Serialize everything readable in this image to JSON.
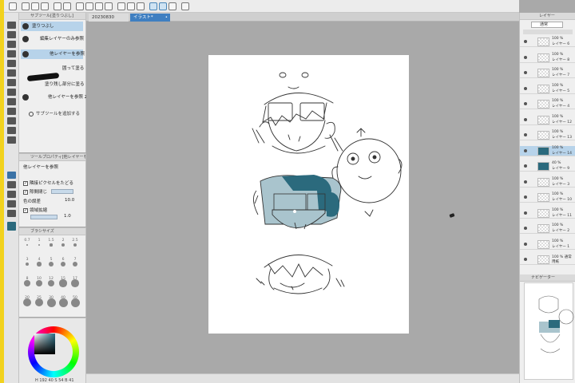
{
  "tabs": [
    {
      "label": "20230830"
    },
    {
      "label": "イラスト*"
    }
  ],
  "subtool": {
    "title": "サブツール[塗りつぶし]",
    "items": [
      {
        "label": "塗りつぶし"
      },
      {
        "label": "編集レイヤーのみ参照"
      },
      {
        "label": "他レイヤーを参照"
      },
      {
        "label": "囲って塗る"
      },
      {
        "label": "塗り残し部分に塗る"
      },
      {
        "label": "他レイヤーを参照 2"
      }
    ],
    "add_label": "サブツールを追加する"
  },
  "tool_property": {
    "title": "ツールプロパティ[他レイヤーを参]",
    "name": "他レイヤーを参照",
    "options": [
      {
        "label": "隣接ピクセルをたどる",
        "checked": true
      },
      {
        "label": "隙間閉じ",
        "checked": true
      },
      {
        "label": "色の誤差",
        "value": "10.0"
      },
      {
        "label": "領域拡縮",
        "checked": true,
        "value": "1.0"
      }
    ]
  },
  "brush_size": {
    "title": "ブラシサイズ",
    "sizes": [
      "0.7",
      "1",
      "1.5",
      "2",
      "2.5",
      "3",
      "4",
      "5",
      "6",
      "7",
      "8",
      "10",
      "12",
      "15",
      "17",
      "20",
      "25",
      "30",
      "40",
      "50"
    ]
  },
  "color": {
    "readout": "H 192  40  S 54  B 41",
    "current": "#2b6a7d"
  },
  "layers": {
    "title": "レイヤー",
    "blend_mode": "通常",
    "rows": [
      {
        "pct": "100 %",
        "name": "レイヤー 6"
      },
      {
        "pct": "100 %",
        "name": "レイヤー 8"
      },
      {
        "pct": "100 %",
        "name": "レイヤー 7"
      },
      {
        "pct": "100 %",
        "name": "レイヤー 5"
      },
      {
        "pct": "100 %",
        "name": "レイヤー 4"
      },
      {
        "pct": "100 %",
        "name": "レイヤー 12"
      },
      {
        "pct": "100 %",
        "name": "レイヤー 13"
      },
      {
        "pct": "100 %",
        "name": "レイヤー 14"
      },
      {
        "pct": "40 %",
        "name": "レイヤー 9"
      },
      {
        "pct": "100 %",
        "name": "レイヤー 3"
      },
      {
        "pct": "100 %",
        "name": "レイヤー 10"
      },
      {
        "pct": "100 %",
        "name": "レイヤー 11"
      },
      {
        "pct": "100 %",
        "name": "レイヤー 2"
      },
      {
        "pct": "100 %",
        "name": "レイヤー 1"
      },
      {
        "pct": "100 % 通常",
        "name": "用紙"
      }
    ],
    "selected_index": 7
  },
  "navigator": {
    "title": "ナビゲーター"
  },
  "accent": "#3f7fc1",
  "fill_color": "#2b6a7d",
  "fill_light": "#a9c4cd"
}
